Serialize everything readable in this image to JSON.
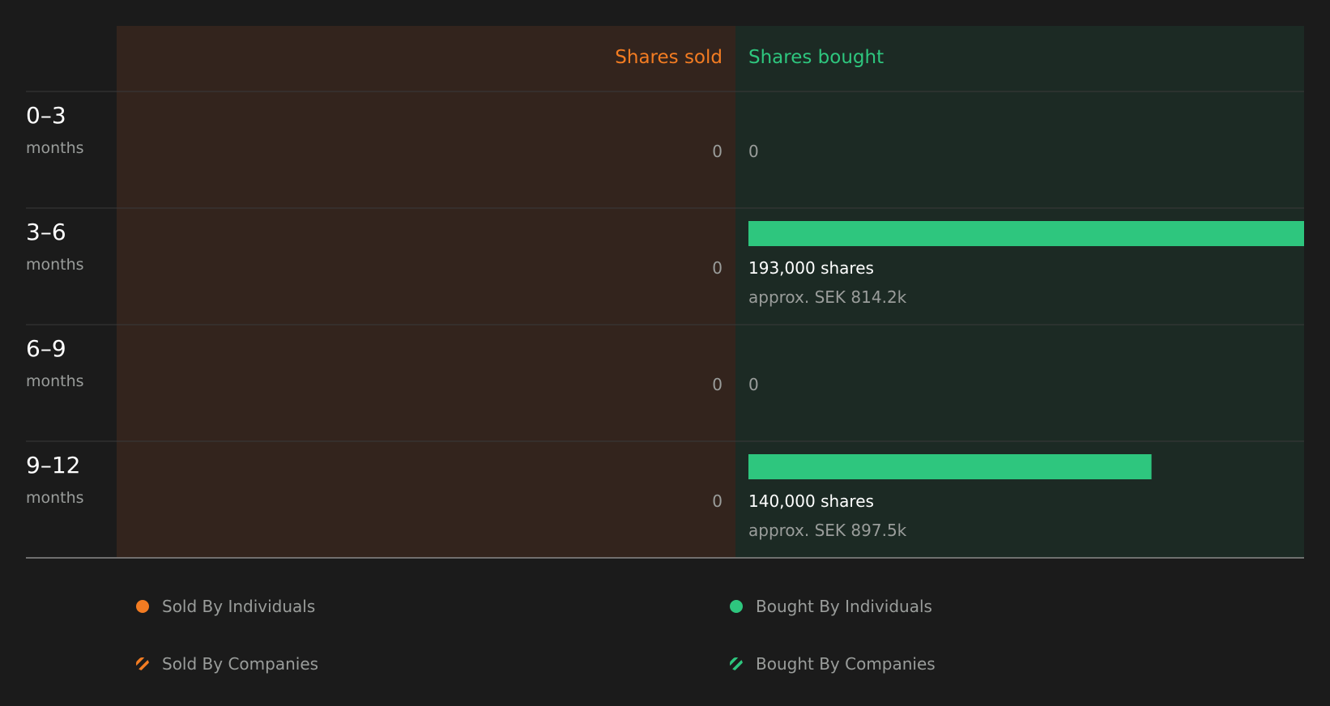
{
  "colors": {
    "background": "#1b1b1b",
    "sold_accent": "#f37c22",
    "bought_accent": "#2ec67e",
    "sold_panel": "#33241d",
    "bought_panel": "#1c2a24",
    "text_primary": "#ffffff",
    "text_muted": "#9a9d9b"
  },
  "chart_data": {
    "type": "bar",
    "orientation": "horizontal",
    "columns": {
      "sold": "Shares sold",
      "bought": "Shares bought"
    },
    "rows": [
      {
        "period": "0–3",
        "unit": "months",
        "sold": 0,
        "sold_label": "0",
        "bought": 0,
        "bought_label": "0",
        "bought_value_label": ""
      },
      {
        "period": "3–6",
        "unit": "months",
        "sold": 0,
        "sold_label": "0",
        "bought": 193000,
        "bought_label": "193,000 shares",
        "bought_value_label": "approx. SEK 814.2k"
      },
      {
        "period": "6–9",
        "unit": "months",
        "sold": 0,
        "sold_label": "0",
        "bought": 0,
        "bought_label": "0",
        "bought_value_label": ""
      },
      {
        "period": "9–12",
        "unit": "months",
        "sold": 0,
        "sold_label": "0",
        "bought": 140000,
        "bought_label": "140,000 shares",
        "bought_value_label": "approx. SEK 897.5k"
      }
    ],
    "bought_max": 193000,
    "legend": [
      {
        "label": "Sold By Individuals",
        "marker": "solid-dot",
        "color": "#f37c22"
      },
      {
        "label": "Bought By Individuals",
        "marker": "solid-dot",
        "color": "#2ec67e"
      },
      {
        "label": "Sold By Companies",
        "marker": "striped-dot",
        "color": "#f37c22"
      },
      {
        "label": "Bought By Companies",
        "marker": "striped-dot",
        "color": "#2ec67e"
      }
    ]
  }
}
